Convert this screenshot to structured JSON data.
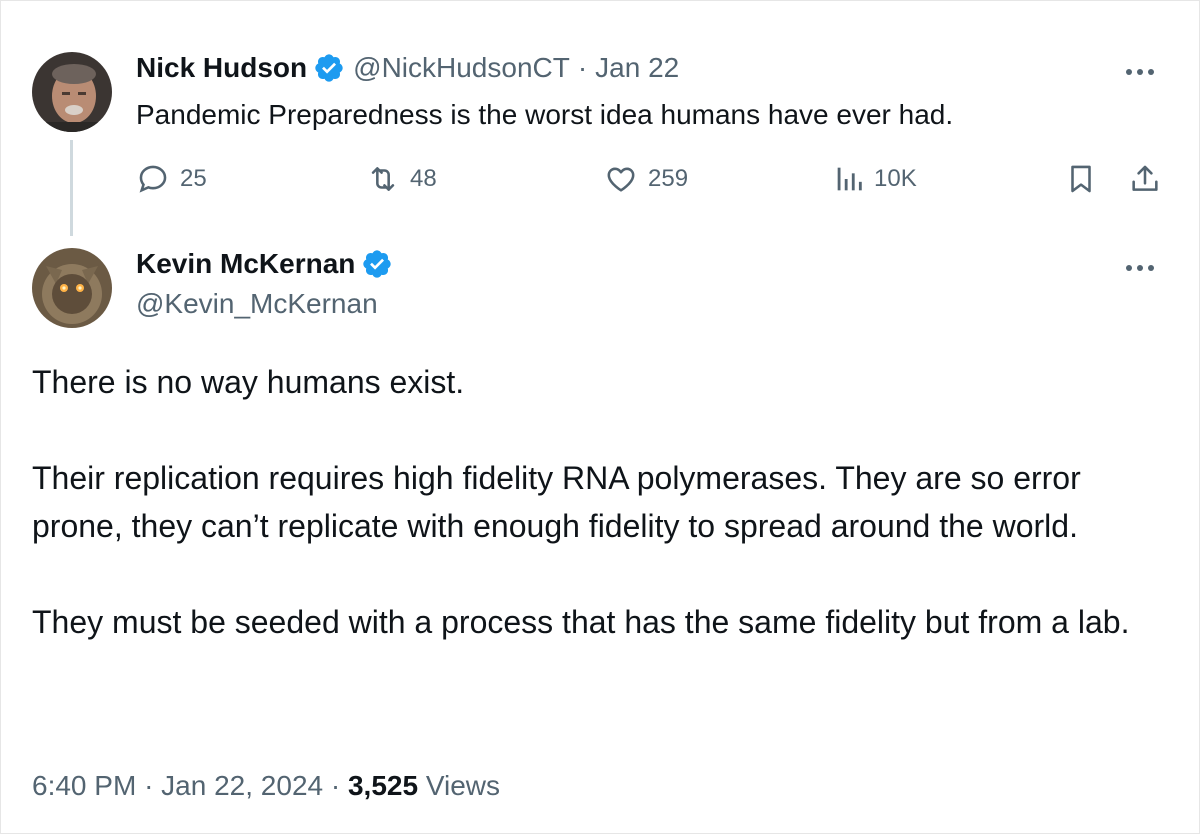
{
  "parent_tweet": {
    "author_name": "Nick Hudson",
    "handle": "@NickHudsonCT",
    "separator": "·",
    "date": "Jan 22",
    "text": "Pandemic Preparedness is the worst idea humans have ever had.",
    "replies": "25",
    "reposts": "48",
    "likes": "259",
    "views": "10K",
    "avatar_icon": "avatar-photo-icon",
    "verified_icon": "verified-badge-icon"
  },
  "main_tweet": {
    "author_name": "Kevin McKernan",
    "handle": "@Kevin_McKernan",
    "paragraphs": [
      "There is no way humans exist.",
      "Their replication requires high fidelity RNA polymerases. They are so error prone, they can’t replicate with enough fidelity to spread around the world.",
      "They must be seeded with a process that has the same fidelity but from a lab."
    ],
    "time": "6:40 PM",
    "separator": "·",
    "full_date": "Jan 22, 2024",
    "separator2": "·",
    "view_count": "3,525",
    "views_label": "Views",
    "avatar_icon": "avatar-photo-icon",
    "verified_icon": "verified-badge-icon"
  },
  "colors": {
    "text_primary": "#0f1419",
    "text_secondary": "#536471",
    "verified_blue": "#1d9bf0",
    "thread_line": "#cfd9de"
  }
}
